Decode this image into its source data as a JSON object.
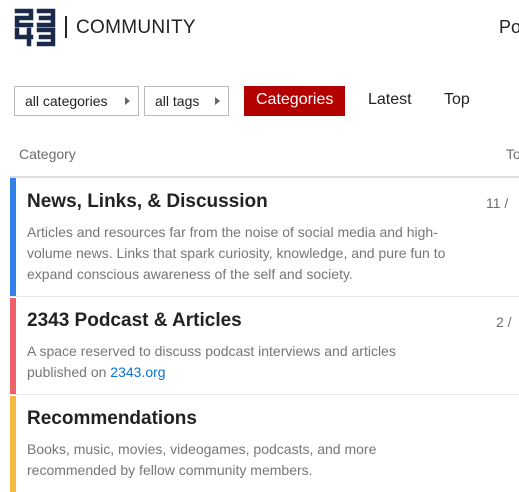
{
  "header": {
    "logo_icon": "2343-logo-icon",
    "logo_text": "COMMUNITY",
    "right_link": "Po"
  },
  "nav": {
    "categories_dropdown": "all categories",
    "tags_dropdown": "all tags",
    "tabs": [
      {
        "label": "Categories",
        "active": true
      },
      {
        "label": "Latest",
        "active": false
      },
      {
        "label": "Top",
        "active": false
      }
    ],
    "accent_color": "#b30000"
  },
  "table": {
    "headers": {
      "category": "Category",
      "topics": "To"
    },
    "rows": [
      {
        "title": "News, Links, & Discussion",
        "description": "Articles and resources far from the noise of social media and high-volume news. Links that spark curiosity, knowledge, and pure fun to expand conscious awareness of the self and society.",
        "count": "11 /",
        "color": "#2f80e8"
      },
      {
        "title": "2343 Podcast & Articles",
        "description_prefix": "A space reserved to discuss podcast interviews and articles published on ",
        "description_link": "2343.org",
        "count": "2 /",
        "color": "#f0606a"
      },
      {
        "title": "Recommendations",
        "description": "Books, music, movies, videogames, podcasts, and more recommended by fellow community members.",
        "color": "#f5b942"
      }
    ]
  }
}
